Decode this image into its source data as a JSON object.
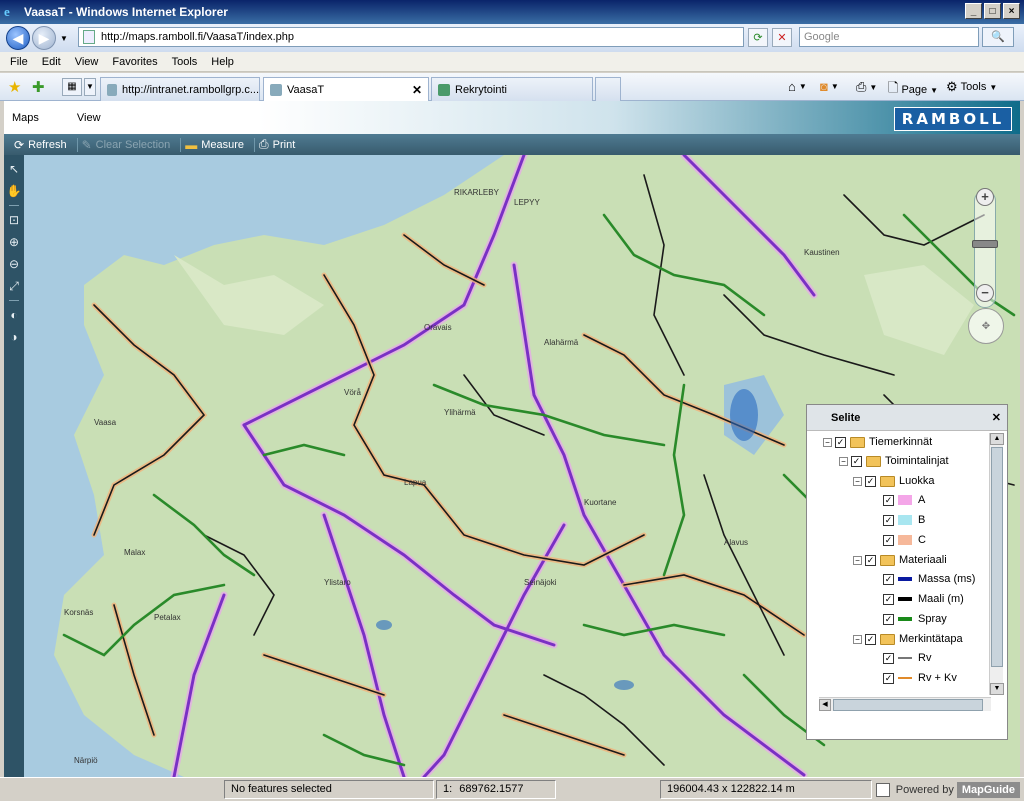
{
  "window": {
    "title": "VaasaT - Windows Internet Explorer",
    "controls": [
      "_",
      "□",
      "×"
    ]
  },
  "address": {
    "url": "http://maps.ramboll.fi/VaasaT/index.php",
    "search_placeholder": "Google"
  },
  "menu": [
    "File",
    "Edit",
    "View",
    "Favorites",
    "Tools",
    "Help"
  ],
  "tabs": [
    {
      "label": "http://intranet.rambollgrp.c...",
      "active": false
    },
    {
      "label": "VaasaT",
      "active": true
    },
    {
      "label": "Rekrytointi",
      "active": false
    }
  ],
  "ie_commands": {
    "page": "Page",
    "tools": "Tools"
  },
  "app": {
    "menu": [
      "Maps",
      "View"
    ],
    "logo": "RAMBOLL",
    "toolbar": {
      "refresh": "Refresh",
      "clear_selection": "Clear Selection",
      "measure": "Measure",
      "print": "Print"
    }
  },
  "legend": {
    "title": "Selite",
    "items": [
      {
        "label": "Tiemerkinnät",
        "level": 0,
        "kind": "folder"
      },
      {
        "label": "Toimintalinjat",
        "level": 1,
        "kind": "folder"
      },
      {
        "label": "Luokka",
        "level": 2,
        "kind": "folder"
      },
      {
        "label": "A",
        "level": 3,
        "kind": "swatch",
        "color": "#f4a6e8"
      },
      {
        "label": "B",
        "level": 3,
        "kind": "swatch",
        "color": "#a8e6f0"
      },
      {
        "label": "C",
        "level": 3,
        "kind": "swatch",
        "color": "#f6b89a"
      },
      {
        "label": "Materiaali",
        "level": 2,
        "kind": "folder"
      },
      {
        "label": "Massa (ms)",
        "level": 3,
        "kind": "swatch",
        "color": "#0a1aa0"
      },
      {
        "label": "Maali (m)",
        "level": 3,
        "kind": "swatch",
        "color": "#000000"
      },
      {
        "label": "Spray",
        "level": 3,
        "kind": "swatch",
        "color": "#1a8a1a"
      },
      {
        "label": "Merkintätapa",
        "level": 2,
        "kind": "folder"
      },
      {
        "label": "Rv",
        "level": 3,
        "kind": "line",
        "color": "#777777"
      },
      {
        "label": "Rv + Kv",
        "level": 3,
        "kind": "line",
        "color": "#e08a2a"
      }
    ]
  },
  "status": {
    "selection": "No features selected",
    "scale_prefix": "1:",
    "scale": "689762.1577",
    "coords": "196004.43 x 122822.14 m",
    "powered_by": "Powered by",
    "brand": "MapGuide"
  },
  "colors": {
    "road_purple": "#8a3ad0",
    "road_orange": "#e08a2a",
    "road_green": "#2a8a2a",
    "road_dark": "#1a1a1a",
    "land": "#c9dfb5",
    "sea": "#a8cbe0"
  }
}
